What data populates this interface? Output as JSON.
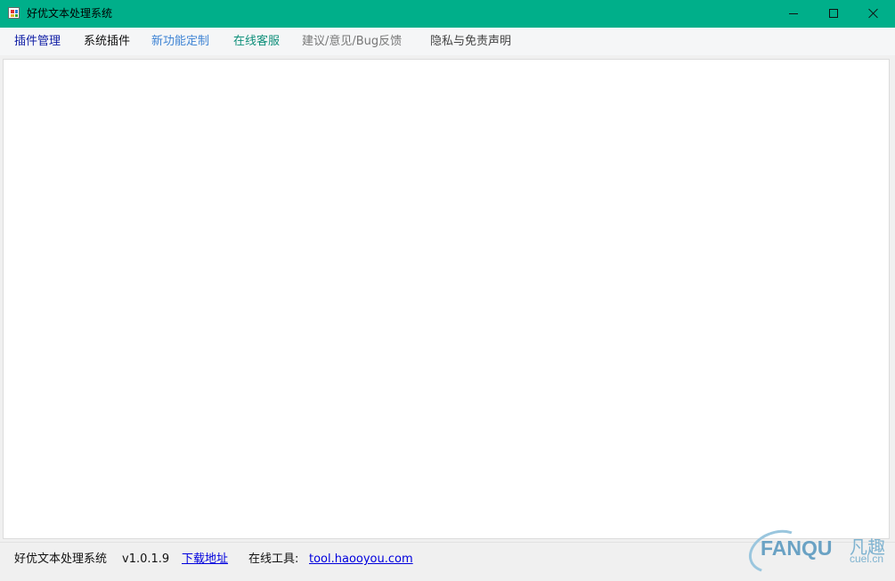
{
  "window": {
    "title": "好优文本处理系统",
    "controls": {
      "minimize_icon": "minimize-icon",
      "maximize_icon": "maximize-icon",
      "close_icon": "close-icon"
    },
    "titlebar_color": "#00af8a"
  },
  "menu": {
    "items": [
      {
        "label": "插件管理",
        "color": "#1220a6"
      },
      {
        "label": "系统插件",
        "color": "#111111"
      },
      {
        "label": "新功能定制",
        "color": "#3f84d4"
      },
      {
        "label": "在线客服",
        "color": "#0e8f7a"
      },
      {
        "label": "建议/意见/Bug反馈",
        "color": "#777777"
      },
      {
        "label": "隐私与免责声明",
        "color": "#444444"
      }
    ]
  },
  "status": {
    "app_name": "好优文本处理系统",
    "version": "v1.0.1.9",
    "download_link": "下载地址",
    "tools_label": "在线工具:",
    "tools_url": "tool.haooyou.com"
  },
  "watermark": {
    "brand": "FANQU",
    "brand_cn": "凡趣",
    "domain": "cuel.cn"
  }
}
